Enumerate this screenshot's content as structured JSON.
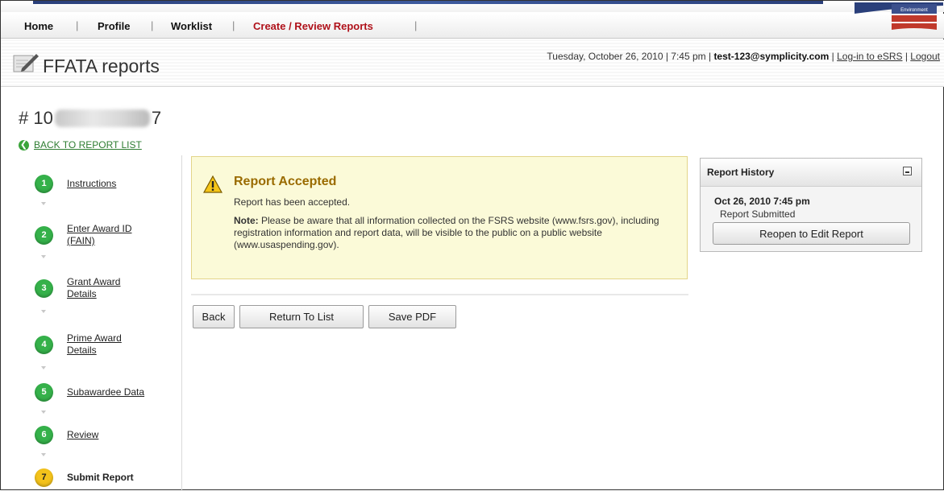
{
  "nav": {
    "items": [
      "Home",
      "Profile",
      "Worklist",
      "Create / Review Reports"
    ],
    "separator": "|",
    "active_color": "#b0121b"
  },
  "header": {
    "title": "FFATA reports",
    "logo_text": "Environment",
    "userline_prefix": "Tuesday, October 26, 2010 | 7:45 pm | ",
    "user_email": "test-123@symplicity.com",
    "sep": " | ",
    "login_link": "Log-in to eSRS",
    "logout_link": "Logout"
  },
  "report": {
    "number_prefix": "# 10",
    "number_suffix": "7",
    "back_link": "BACK TO REPORT LIST"
  },
  "steps": [
    {
      "num": "1",
      "label": "Instructions",
      "status": "complete"
    },
    {
      "num": "2",
      "label": "Enter Award ID (FAIN)",
      "status": "complete"
    },
    {
      "num": "3",
      "label": "Grant Award Details",
      "status": "complete"
    },
    {
      "num": "4",
      "label": "Prime Award Details",
      "status": "complete"
    },
    {
      "num": "5",
      "label": "Subawardee Data",
      "status": "complete"
    },
    {
      "num": "6",
      "label": "Review",
      "status": "complete"
    },
    {
      "num": "7",
      "label": "Submit Report",
      "status": "current"
    }
  ],
  "alert": {
    "icon": "warning-icon",
    "title": "Report Accepted",
    "message": "Report has been accepted.",
    "note_label": "Note:",
    "note_text": " Please be aware that all information collected on the FSRS website (www.fsrs.gov), including registration information and report data, will be visible to the public on a public website (www.usaspending.gov)."
  },
  "buttons": {
    "back": "Back",
    "return_to_list": "Return To List",
    "save_pdf": "Save PDF"
  },
  "history": {
    "title": "Report History",
    "entries": [
      {
        "date": "Oct 26, 2010 7:45 pm",
        "status": "Report Submitted"
      }
    ],
    "reopen_label": "Reopen to Edit Report"
  },
  "colors": {
    "step_complete": "#35b14a",
    "step_current": "#f3c21b",
    "alert_bg": "#fbfad8",
    "alert_title": "#9a6b00",
    "link_green": "#2e7d32"
  }
}
